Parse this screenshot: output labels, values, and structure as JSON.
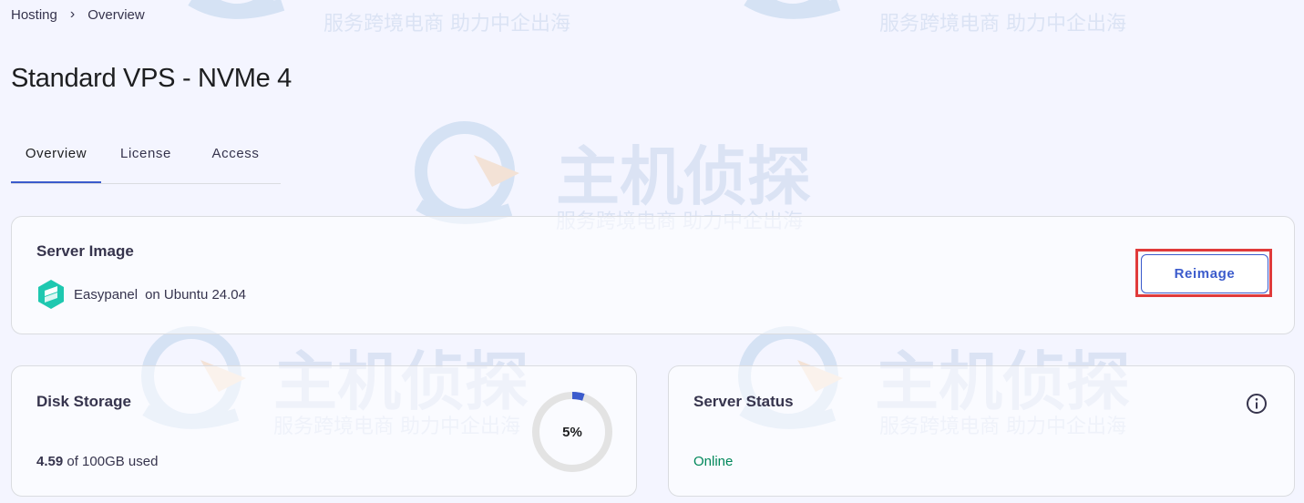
{
  "breadcrumb": {
    "items": [
      "Hosting",
      "Overview"
    ],
    "separator": "›"
  },
  "page": {
    "title": "Standard VPS - NVMe 4"
  },
  "tabs": [
    {
      "label": "Overview",
      "active": true
    },
    {
      "label": "License",
      "active": false
    },
    {
      "label": "Access",
      "active": false
    }
  ],
  "server_image": {
    "title": "Server Image",
    "app_name": "Easypanel",
    "os_text": "on Ubuntu 24.04",
    "logo_icon": "easypanel-logo-icon",
    "reimage_label": "Reimage"
  },
  "disk_storage": {
    "title": "Disk Storage",
    "used_value": "4.59",
    "used_suffix": "of 100GB used",
    "percent": 5,
    "percent_label": "5%"
  },
  "server_status": {
    "title": "Server Status",
    "status": "Online",
    "info_icon": "info-icon"
  },
  "watermark": {
    "brand": "主机侦探",
    "slogan": "服务跨境电商 助力中企出海"
  },
  "colors": {
    "accent": "#3b5bcc",
    "highlight": "#e03b3b",
    "online": "#00875a",
    "gauge_track": "#e3e3e3",
    "logo_teal": "#1ec8b0"
  }
}
